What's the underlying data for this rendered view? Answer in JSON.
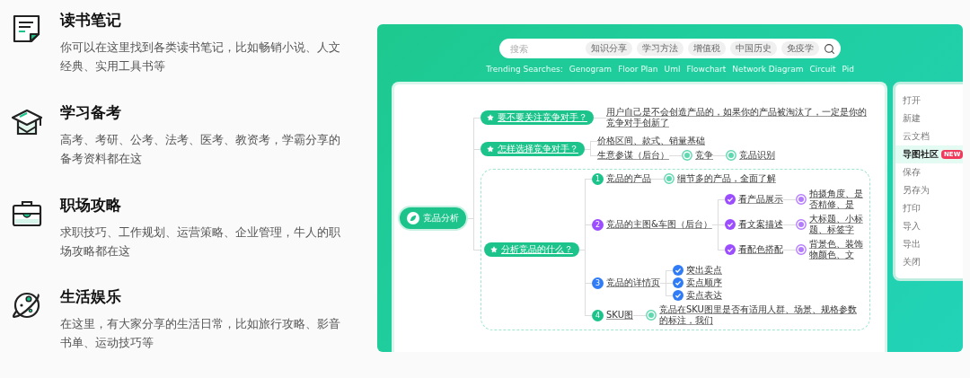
{
  "features": [
    {
      "title": "读书笔记",
      "description": "你可以在这里找到各类读书笔记，比如畅销小说、人文经典、实用工具书等"
    },
    {
      "title": "学习备考",
      "description": "高考、考研、公考、法考、医考、教资考，学霸分享的备考资料都在这"
    },
    {
      "title": "职场攻略",
      "description": "求职技巧、工作规划、运营策略、企业管理，牛人的职场攻略都在这"
    },
    {
      "title": "生活娱乐",
      "description": "在这里，有大家分享的生活日常，比如旅行攻略、影音书单、运动技巧等"
    }
  ],
  "showcase": {
    "search": {
      "placeholder": "搜索",
      "chips": [
        "知识分享",
        "学习方法",
        "增值税",
        "中国历史",
        "免疫学"
      ]
    },
    "trending": {
      "label": "Trending Searches:",
      "items": [
        "Genogram",
        "Floor Plan",
        "Uml",
        "Flowchart",
        "Network Diagram",
        "Circuit",
        "Pid"
      ]
    },
    "mind_map": {
      "root": {
        "kind": "root",
        "text": "竞品分析",
        "children": [
          {
            "kind": "topic",
            "text": "要不要关注竞争对手？",
            "framed": false,
            "children": [
              {
                "kind": "text",
                "text": "用户自己是不会创造产品的，如果你的产品被淘汰了，一定是你的竞争对手创新了"
              }
            ]
          },
          {
            "kind": "topic",
            "text": "怎样选择竞争对手？",
            "framed": false,
            "children": [
              {
                "kind": "text",
                "text": "价格区间、款式、销量基础"
              },
              {
                "kind": "text",
                "text": "生意参谋（后台）",
                "children": [
                  {
                    "kind": "note",
                    "color": "#5fd8b0",
                    "text": "竞争",
                    "children": [
                      {
                        "kind": "note",
                        "color": "#5fd8b0",
                        "text": "竞品识别"
                      }
                    ]
                  }
                ]
              }
            ]
          },
          {
            "kind": "topic",
            "text": "分析竞品的什么？",
            "framed": true,
            "children": [
              {
                "kind": "numbered",
                "number": "1",
                "color": "#1cc48b",
                "text": "竞品的产品",
                "children": [
                  {
                    "kind": "note",
                    "color": "#5fd8b0",
                    "text": "细节多的产品，全面了解"
                  }
                ]
              },
              {
                "kind": "numbered",
                "number": "2",
                "color": "#9b4dff",
                "text": "竞品的主图&车图（后台）",
                "children": [
                  {
                    "kind": "check",
                    "color": "#9b4dff",
                    "text": "看产品展示",
                    "children": [
                      {
                        "kind": "note",
                        "color": "#b57bff",
                        "text": "拍摄角度、是否精修、是"
                      }
                    ]
                  },
                  {
                    "kind": "check",
                    "color": "#9b4dff",
                    "text": "看文案描述",
                    "children": [
                      {
                        "kind": "note",
                        "color": "#b57bff",
                        "text": "大标题、小标题、标签字"
                      }
                    ]
                  },
                  {
                    "kind": "check",
                    "color": "#9b4dff",
                    "text": "看配色搭配",
                    "children": [
                      {
                        "kind": "note",
                        "color": "#b57bff",
                        "text": "背景色、装饰物颜色、文"
                      }
                    ]
                  }
                ]
              },
              {
                "kind": "numbered",
                "number": "3",
                "color": "#2f7cf6",
                "text": "竞品的详情页",
                "children": [
                  {
                    "kind": "check",
                    "color": "#2f7cf6",
                    "text": "突出卖点"
                  },
                  {
                    "kind": "check",
                    "color": "#2f7cf6",
                    "text": "卖点顺序"
                  },
                  {
                    "kind": "check",
                    "color": "#2f7cf6",
                    "text": "卖点表达"
                  }
                ]
              },
              {
                "kind": "numbered",
                "number": "4",
                "color": "#1cc48b",
                "text": "SKU图",
                "children": [
                  {
                    "kind": "note",
                    "color": "#5fd8b0",
                    "text": "竞品在SKU图里是否有适用人群、场景、规格参数的标注，我们"
                  }
                ]
              }
            ]
          }
        ]
      }
    },
    "menu": [
      {
        "label": "打开",
        "selected": false
      },
      {
        "label": "新建",
        "selected": false
      },
      {
        "label": "云文档",
        "selected": false
      },
      {
        "label": "导图社区",
        "selected": true,
        "badge": "NEW"
      },
      {
        "label": "保存",
        "selected": false
      },
      {
        "label": "另存为",
        "selected": false
      },
      {
        "label": "打印",
        "selected": false
      },
      {
        "label": "导入",
        "selected": false
      },
      {
        "label": "导出",
        "selected": false
      },
      {
        "label": "关闭",
        "selected": false
      }
    ]
  }
}
